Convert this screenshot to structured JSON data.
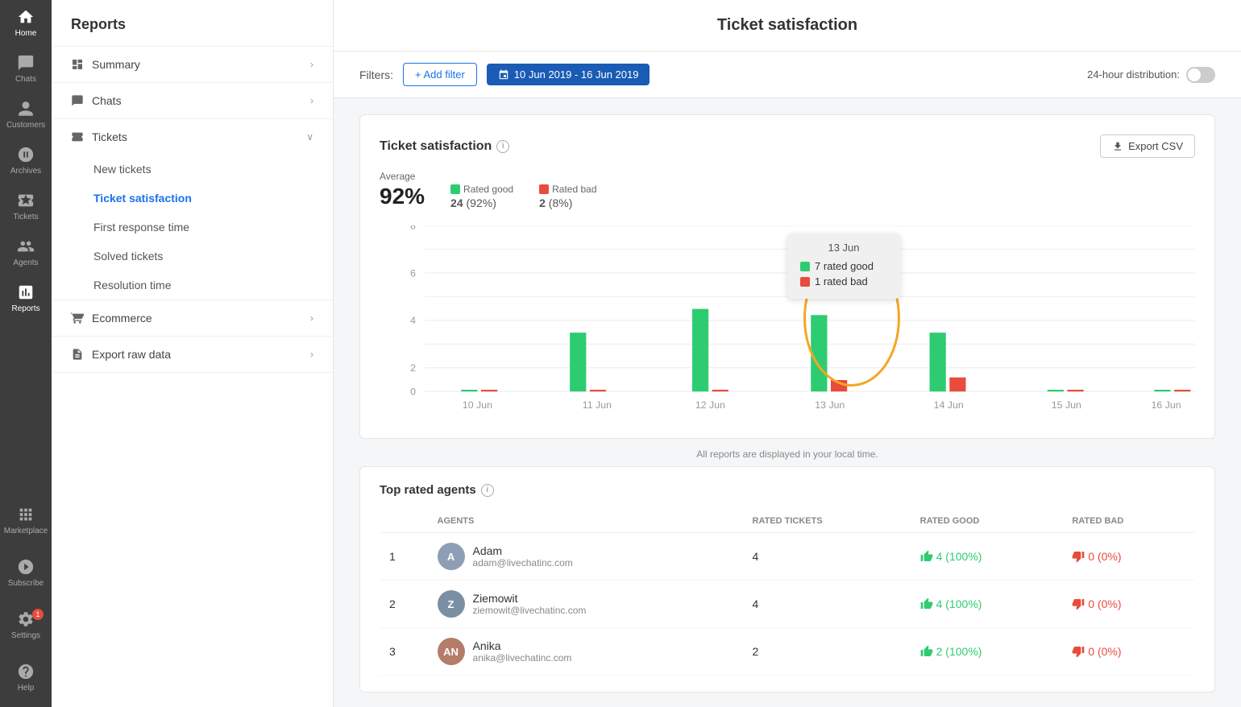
{
  "app": {
    "title": "Ticket satisfaction"
  },
  "icon_nav": {
    "items": [
      {
        "id": "home",
        "label": "Home",
        "icon": "home"
      },
      {
        "id": "chats",
        "label": "Chats",
        "icon": "chat"
      },
      {
        "id": "customers",
        "label": "Customers",
        "icon": "person"
      },
      {
        "id": "archives",
        "label": "Archives",
        "icon": "clock"
      },
      {
        "id": "tickets",
        "label": "Tickets",
        "icon": "ticket"
      },
      {
        "id": "agents",
        "label": "Agents",
        "icon": "agents"
      },
      {
        "id": "reports",
        "label": "Reports",
        "icon": "reports",
        "active": true
      }
    ],
    "bottom_items": [
      {
        "id": "marketplace",
        "label": "Marketplace",
        "icon": "grid"
      },
      {
        "id": "subscribe",
        "label": "Subscribe",
        "icon": "subscribe"
      },
      {
        "id": "settings",
        "label": "Settings",
        "icon": "settings"
      },
      {
        "id": "help",
        "label": "Help",
        "icon": "help"
      }
    ]
  },
  "sidebar": {
    "title": "Reports",
    "items": [
      {
        "id": "summary",
        "label": "Summary",
        "icon": "bar",
        "hasChevron": true
      },
      {
        "id": "chats",
        "label": "Chats",
        "icon": "chat",
        "hasChevron": true
      },
      {
        "id": "tickets",
        "label": "Tickets",
        "icon": "ticket",
        "hasChevron": true,
        "expanded": true,
        "sub_items": [
          {
            "id": "new-tickets",
            "label": "New tickets",
            "active": false
          },
          {
            "id": "ticket-satisfaction",
            "label": "Ticket satisfaction",
            "active": true
          },
          {
            "id": "first-response-time",
            "label": "First response time",
            "active": false
          },
          {
            "id": "solved-tickets",
            "label": "Solved tickets",
            "active": false
          },
          {
            "id": "resolution-time",
            "label": "Resolution time",
            "active": false
          }
        ]
      },
      {
        "id": "ecommerce",
        "label": "Ecommerce",
        "icon": "cart",
        "hasChevron": true
      },
      {
        "id": "export-raw-data",
        "label": "Export raw data",
        "icon": "file",
        "hasChevron": true
      }
    ]
  },
  "filters": {
    "label": "Filters:",
    "add_filter_label": "+ Add filter",
    "date_range_label": "10 Jun 2019 - 16 Jun 2019",
    "distribution_label": "24-hour distribution:"
  },
  "chart": {
    "title": "Ticket satisfaction",
    "export_label": "Export CSV",
    "average_label": "Average",
    "average_value": "92%",
    "rated_good_label": "Rated good",
    "rated_good_value": "24",
    "rated_good_pct": "(92%)",
    "rated_bad_label": "Rated bad",
    "rated_bad_value": "2",
    "rated_bad_pct": "(8%)",
    "tooltip": {
      "date": "13 Jun",
      "good_label": "7 rated good",
      "bad_label": "1 rated bad"
    },
    "bars": [
      {
        "label": "10 Jun",
        "good": 0.1,
        "bad": 0.1
      },
      {
        "label": "11 Jun",
        "good": 5,
        "bad": 0.1
      },
      {
        "label": "12 Jun",
        "good": 7,
        "bad": 0.1
      },
      {
        "label": "13 Jun",
        "good": 6.5,
        "bad": 1
      },
      {
        "label": "14 Jun",
        "good": 5,
        "bad": 1.2
      },
      {
        "label": "15 Jun",
        "good": 0.1,
        "bad": 0.1
      },
      {
        "label": "16 Jun",
        "good": 0,
        "bad": 0.1
      }
    ],
    "y_max": 8
  },
  "bottom_note": "All reports are displayed in your local time.",
  "agents_table": {
    "title": "Top rated agents",
    "headers": [
      "",
      "AGENTS",
      "RATED TICKETS",
      "RATED GOOD",
      "RATED BAD"
    ],
    "rows": [
      {
        "rank": "1",
        "name": "Adam",
        "email": "adam@livechatinc.com",
        "rated_tickets": "4",
        "rated_good": "4 (100%)",
        "rated_bad": "0 (0%)",
        "avatar_color": "#8e9eb5",
        "avatar_initials": "A"
      },
      {
        "rank": "2",
        "name": "Ziemowit",
        "email": "ziemowit@livechatinc.com",
        "rated_tickets": "4",
        "rated_good": "4 (100%)",
        "rated_bad": "0 (0%)",
        "avatar_color": "#7a8fa3",
        "avatar_initials": "Z"
      },
      {
        "rank": "3",
        "name": "Anika",
        "email": "anika@livechatinc.com",
        "rated_tickets": "2",
        "rated_good": "2 (100%)",
        "rated_bad": "0 (0%)",
        "avatar_color": "#b57c6a",
        "avatar_initials": "AN"
      }
    ]
  }
}
